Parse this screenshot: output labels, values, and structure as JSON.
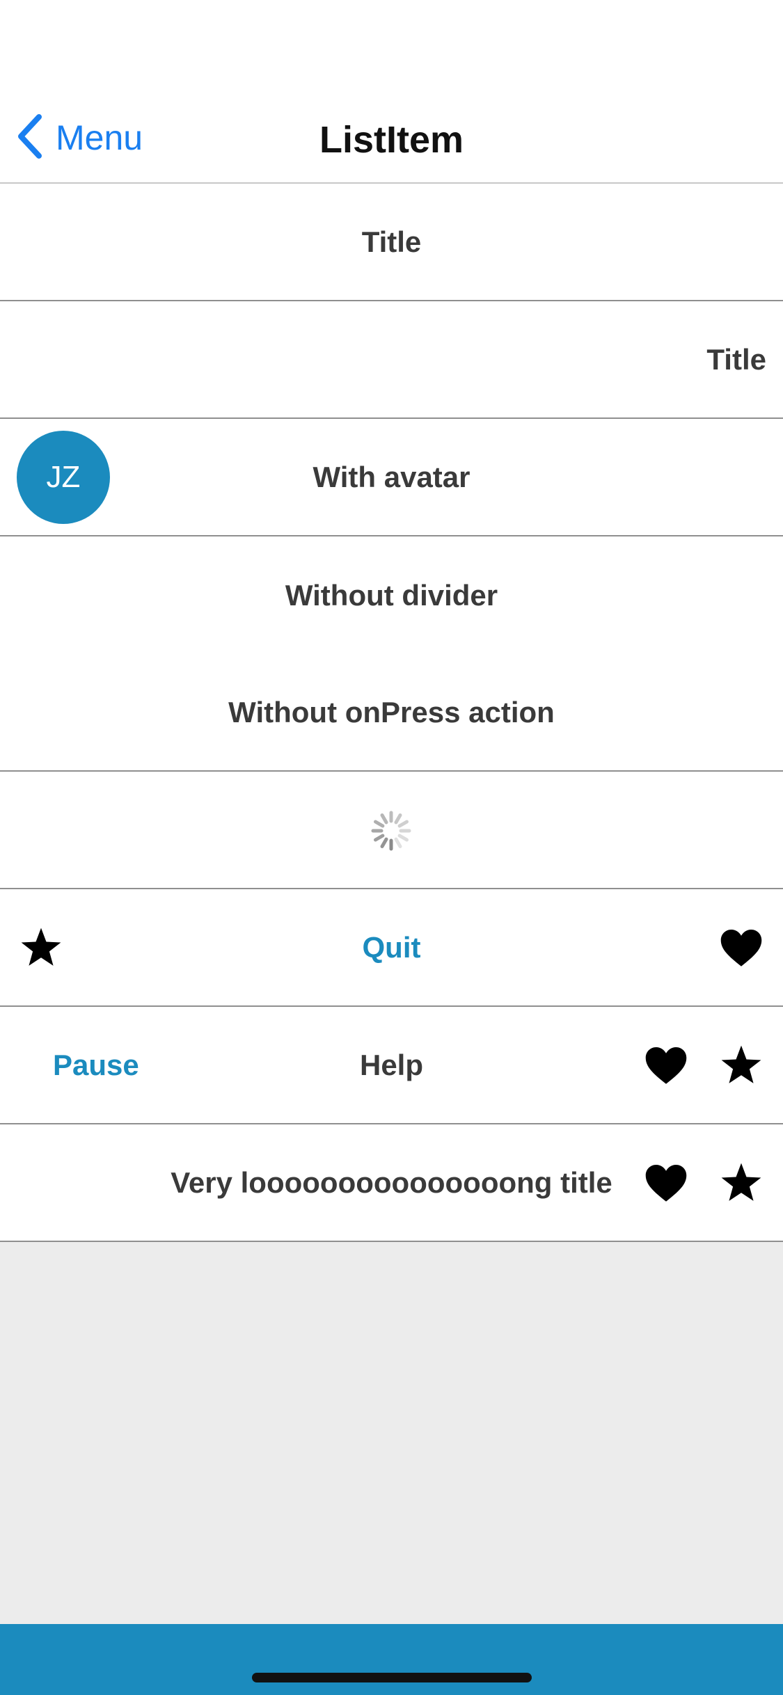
{
  "nav": {
    "back_label": "Menu",
    "title": "ListItem"
  },
  "rows": {
    "centered_title": "Title",
    "right_title": "Title",
    "avatar_initials": "JZ",
    "avatar_title": "With avatar",
    "without_divider_title": "Without divider",
    "without_action_title": "Without onPress action",
    "quit_label": "Quit",
    "pause_label": "Pause",
    "help_title": "Help",
    "long_title": "Very looooooooooooooong title"
  },
  "icons": {
    "back": "chevron-left-icon",
    "loading": "spinner-icon",
    "star": "star-icon",
    "heart": "heart-icon"
  },
  "colors": {
    "accent": "#1b8bbe",
    "ios_link": "#1a7ff0",
    "row_text": "#3a3a3a",
    "background": "#ececec"
  }
}
